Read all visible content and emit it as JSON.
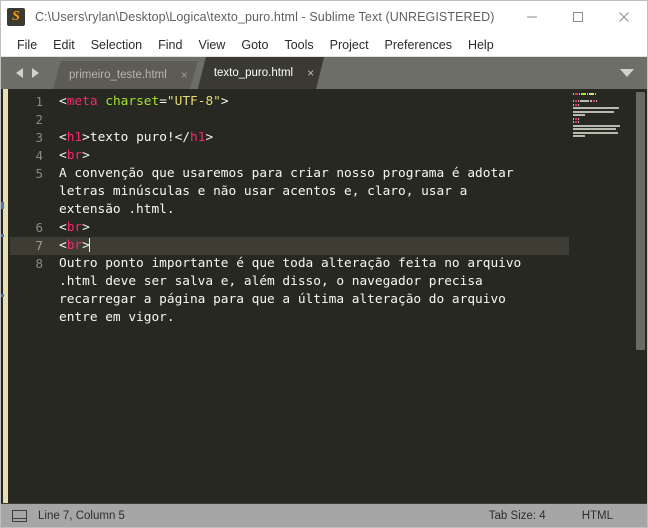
{
  "window": {
    "title": "C:\\Users\\rylan\\Desktop\\Logica\\texto_puro.html - Sublime Text (UNREGISTERED)",
    "logo_letter": "S",
    "controls": {
      "minimize": "minimize-icon",
      "maximize": "maximize-icon",
      "close": "close-icon"
    },
    "colors": {
      "titlebar_bg": "#ffffff",
      "title_fg": "#5f5f5f",
      "tabbar_bg": "#6e6e69",
      "editor_bg": "#272822",
      "active_tab_bg": "#3a3a32",
      "inactive_tab_bg": "#5c5b56",
      "statusbar_bg": "#a6a6a6",
      "accent_tag": "#f92672",
      "accent_attr": "#a6e22e",
      "accent_string": "#e6db74",
      "left_bar": "#e6e0ae"
    }
  },
  "menubar": {
    "items": [
      {
        "label": "File"
      },
      {
        "label": "Edit"
      },
      {
        "label": "Selection"
      },
      {
        "label": "Find"
      },
      {
        "label": "View"
      },
      {
        "label": "Goto"
      },
      {
        "label": "Tools"
      },
      {
        "label": "Project"
      },
      {
        "label": "Preferences"
      },
      {
        "label": "Help"
      }
    ]
  },
  "tabbar": {
    "nav_prev": "arrow-left-icon",
    "nav_next": "arrow-right-icon",
    "dropdown": "chevron-down-icon",
    "close_glyph": "×",
    "tabs": [
      {
        "label": "primeiro_teste.html",
        "active": false
      },
      {
        "label": "texto_puro.html",
        "active": true
      }
    ]
  },
  "editor": {
    "active_line": 7,
    "gutter_numbers": [
      "1",
      "2",
      "3",
      "4",
      "5",
      "",
      "",
      "6",
      "7",
      "8",
      "",
      "",
      ""
    ],
    "lines": [
      {
        "num": "1",
        "tokens": [
          {
            "t": "<",
            "c": "punct"
          },
          {
            "t": "meta",
            "c": "tag"
          },
          {
            "t": " ",
            "c": "text"
          },
          {
            "t": "charset",
            "c": "attr"
          },
          {
            "t": "=",
            "c": "punct"
          },
          {
            "t": "\"UTF-8\"",
            "c": "str"
          },
          {
            "t": ">",
            "c": "punct"
          }
        ]
      },
      {
        "num": "2",
        "tokens": []
      },
      {
        "num": "3",
        "tokens": [
          {
            "t": "<",
            "c": "punct"
          },
          {
            "t": "h1",
            "c": "tag"
          },
          {
            "t": ">",
            "c": "punct"
          },
          {
            "t": "texto puro!",
            "c": "text"
          },
          {
            "t": "</",
            "c": "punct"
          },
          {
            "t": "h1",
            "c": "tag"
          },
          {
            "t": ">",
            "c": "punct"
          }
        ]
      },
      {
        "num": "4",
        "tokens": [
          {
            "t": "<",
            "c": "punct"
          },
          {
            "t": "br",
            "c": "tag"
          },
          {
            "t": ">",
            "c": "punct"
          }
        ]
      },
      {
        "num": "5",
        "tokens": [
          {
            "t": "A convenção que usaremos para criar nosso programa é adotar",
            "c": "text"
          }
        ]
      },
      {
        "num": "",
        "tokens": [
          {
            "t": "letras minúsculas e não usar acentos e, claro, usar a",
            "c": "text"
          }
        ]
      },
      {
        "num": "",
        "tokens": [
          {
            "t": "extensão .html.",
            "c": "text"
          }
        ]
      },
      {
        "num": "6",
        "tokens": [
          {
            "t": "<",
            "c": "punct"
          },
          {
            "t": "br",
            "c": "tag"
          },
          {
            "t": ">",
            "c": "punct"
          }
        ]
      },
      {
        "num": "7",
        "tokens": [
          {
            "t": "<",
            "c": "punct"
          },
          {
            "t": "br",
            "c": "tag"
          },
          {
            "t": ">",
            "c": "punct"
          }
        ],
        "active": true
      },
      {
        "num": "8",
        "tokens": [
          {
            "t": "Outro ponto importante é que toda alteração feita no arquivo",
            "c": "text"
          }
        ]
      },
      {
        "num": "",
        "tokens": [
          {
            "t": ".html deve ser salva e, além disso, o navegador precisa",
            "c": "text"
          }
        ]
      },
      {
        "num": "",
        "tokens": [
          {
            "t": "recarregar a página para que a última alteração do arquivo",
            "c": "text"
          }
        ]
      },
      {
        "num": "",
        "tokens": [
          {
            "t": "entre em vigor.",
            "c": "text"
          }
        ]
      }
    ]
  },
  "statusbar": {
    "panel_icon": "panel-layout-icon",
    "cursor_position": "Line 7, Column 5",
    "tab_size": "Tab Size: 4",
    "syntax": "HTML"
  }
}
